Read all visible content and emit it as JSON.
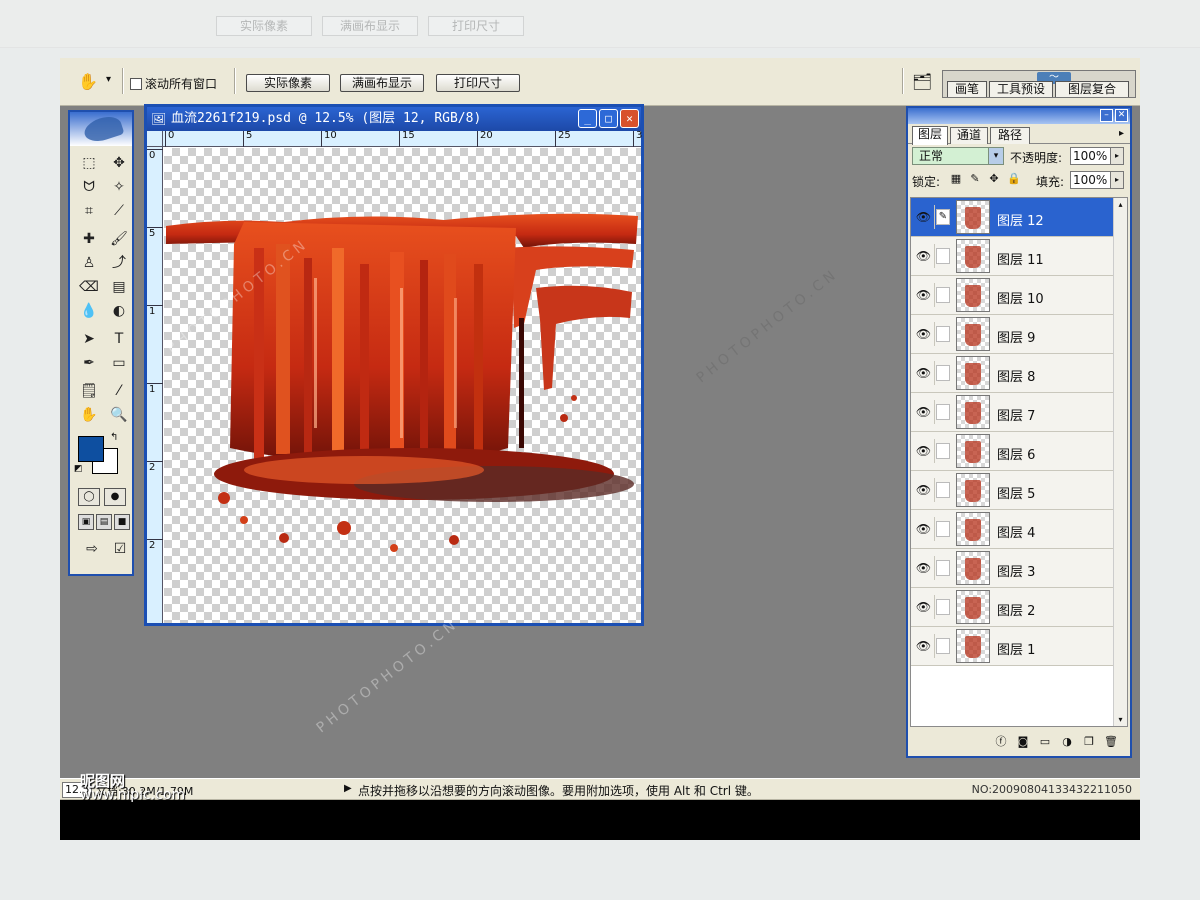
{
  "options_bar": {
    "scroll_all_label": "滚动所有窗口",
    "actual_pixels": "实际像素",
    "fit_on_screen": "满画布显示",
    "print_size": "打印尺寸",
    "tabs": [
      "画笔",
      "工具预设",
      "图层复合"
    ]
  },
  "document": {
    "title": "血流2261f219.psd @ 12.5% (图层 12, RGB/8)",
    "ruler_h_ticks": [
      "0",
      "5",
      "10",
      "15",
      "20",
      "25",
      "3"
    ],
    "ruler_v_ticks": [
      "0",
      "5",
      "1",
      "1",
      "2",
      "2"
    ]
  },
  "layers_panel": {
    "tabs": [
      "图层",
      "通道",
      "路径"
    ],
    "blend_mode": "正常",
    "opacity_label": "不透明度:",
    "opacity_value": "100%",
    "lock_label": "锁定:",
    "fill_label": "填充:",
    "fill_value": "100%",
    "layers": [
      {
        "name": "图层 12",
        "selected": true
      },
      {
        "name": "图层 11",
        "selected": false
      },
      {
        "name": "图层 10",
        "selected": false
      },
      {
        "name": "图层 9",
        "selected": false
      },
      {
        "name": "图层 8",
        "selected": false
      },
      {
        "name": "图层 7",
        "selected": false
      },
      {
        "name": "图层 6",
        "selected": false
      },
      {
        "name": "图层 5",
        "selected": false
      },
      {
        "name": "图层 4",
        "selected": false
      },
      {
        "name": "图层 3",
        "selected": false
      },
      {
        "name": "图层 2",
        "selected": false
      },
      {
        "name": "图层 1",
        "selected": false
      }
    ]
  },
  "status_bar": {
    "zoom": "12.5",
    "doc_info": "文档:30.2M/1.79M",
    "hint": "点按并拖移以沿想要的方向滚动图像。要用附加选项，使用 Alt 和 Ctrl 键。",
    "number": "NO:20090804133432211050"
  },
  "watermarks": {
    "site_name": "昵图网",
    "site_url": "www.nipic.com",
    "photo_text": "PHOTOPHOTO.CN"
  },
  "colors": {
    "foreground": "#0e4fa0",
    "background": "#ffffff",
    "selection": "#2a63cf",
    "title_bar": "#1d49a8"
  }
}
